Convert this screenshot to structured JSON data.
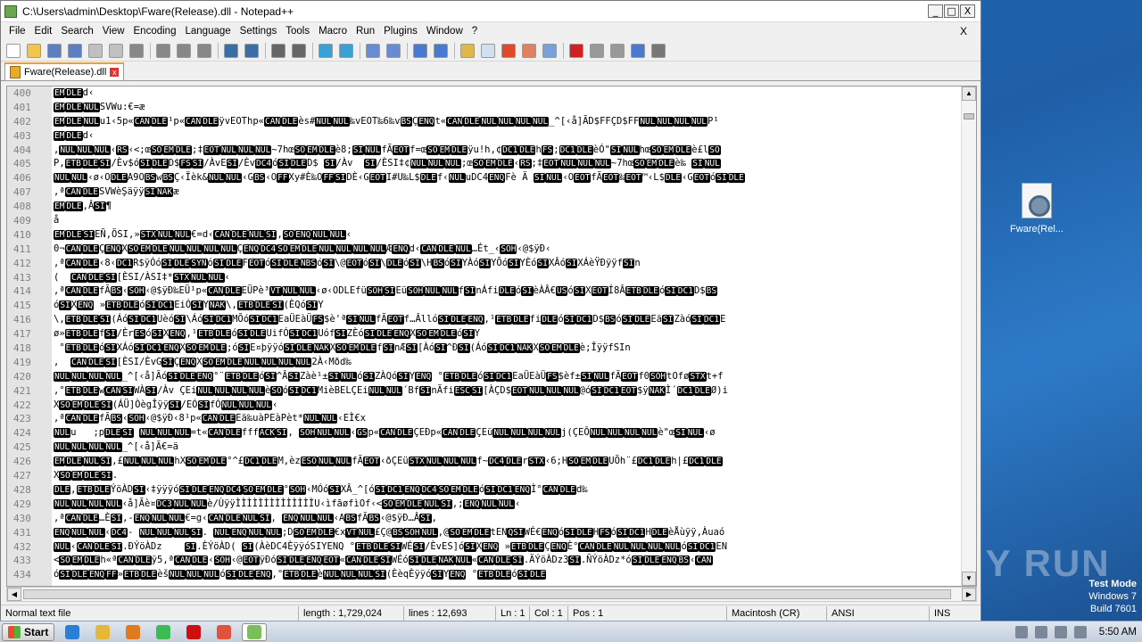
{
  "window": {
    "title": "C:\\Users\\admin\\Desktop\\Fware(Release).dll - Notepad++",
    "min_label": "_",
    "max_label": "□",
    "close_label": "X"
  },
  "menu": {
    "items": [
      "File",
      "Edit",
      "Search",
      "View",
      "Encoding",
      "Language",
      "Settings",
      "Tools",
      "Macro",
      "Run",
      "Plugins",
      "Window",
      "?"
    ],
    "close_label": "X"
  },
  "toolbar": {
    "icons": [
      "new-file-icon",
      "open-file-icon",
      "save-icon",
      "save-all-icon",
      "close-icon",
      "close-all-icon",
      "print-icon",
      "cut-icon",
      "copy-icon",
      "paste-icon",
      "undo-icon",
      "redo-icon",
      "find-icon",
      "replace-icon",
      "zoom-in-icon",
      "zoom-out-icon",
      "sync-v-icon",
      "sync-h-icon",
      "word-wrap-icon",
      "show-all-chars-icon",
      "indent-guide-icon",
      "doc-map-icon",
      "function-list-icon",
      "folder-workspace-icon",
      "monitoring-icon",
      "record-macro-icon",
      "stop-macro-icon",
      "play-macro-icon",
      "play-multiple-icon",
      "save-macro-icon"
    ]
  },
  "tab": {
    "label": "Fware(Release).dll",
    "close_label": "x"
  },
  "editor": {
    "line_numbers": [
      "400",
      "401",
      "402",
      "403",
      "404",
      "405",
      "406",
      "407",
      "408",
      "409",
      "410",
      "411",
      "412",
      "413",
      "414",
      "415",
      "416",
      "417",
      "418",
      "419",
      "420",
      "421",
      "422",
      "423",
      "424",
      "425",
      "426",
      "427",
      "428",
      "429",
      "430",
      "431",
      "432",
      "433",
      "434"
    ],
    "lines": [
      "[EM][DLE]d‹",
      "[EM][DLE][NUL]SVWu:€=æ",
      "[EM][DLE][NUL]u1‹5p«[CAN][DLE]¹p«[CAN][DLE]ÿvEOThp«[CAN][DLE]ès#[NUL][NUL]‰vEOT‰6‰v[BS]Ç[ENQ]t«[CAN][DLE][NUL][NUL][NUL][NUL]_^[‹å]ÃD$FFÇD$FF[NUL][NUL][NUL][NUL]P¹",
      "[EM][DLE]d‹",
      ",[NUL][NUL][NUL]‹[RS]‹<;œ[SO][EM][DLE];‡[EOT][NUL][NUL][NUL]~7hœ[SO][EM][DLE]è8;[SI][NUL]fÃ[EOT]f=œ[SO][EM][DLE]ÿu!h,¢[DC1][DLE]h[FS];[DC1][DLE]èÓ\"[SI][NUL]hœ[SO][EM][DLE]è£l[SO]",
      "P,[ETB][DLE][SI]/Èv$ó[SI][DLE]D$[FS][SI]/ÀvE[SI]/Èv[DC4]ó[SI][DLE]D$ [SI]/Àv  [SI]/ÈSI‡¢[NUL][NUL][NUL];œ[SO][EM][DLE]‹[RS];‡[EOT][NUL][NUL][NUL]~7hœ[SO][EM][DLE]è‰ [SI][NUL]",
      "[NUL][NUL]‹ø‹O[DLE]A9O[BS]w[BS]Ç‹Ïèk&[NUL][NUL]‹G[BS]‹O[FF]Xy#È‰O[FF][SI]DÈ‹G[EOT]I#U‰L$[DLE]f‹[NUL]uDC4[ENQ]Fè Ä [SI][NUL]‹O[EOT]fÃ[EOT]‰[EOT]™‹L$[DLE]‹G[EOT]ó[SI][DLE]",
      ",ª[CAN][DLE]SVWèŞäÿÿ[SI][NAK]æ",
      "[EM][DLE],Â[SI]¶",
      "å",
      "[EM][DLE][SI]EÑ,ÖSI,»[STX][NUL][NUL]€=d‹[CAN][DLE][NUL][SI],[SO][ENQ][NUL][NUL]‹",
      "0¬[CAN][DLE]Ç[ENQ]X[SO][EM][DLE][NUL][NUL][NUL][NUL]Ç[ENQ][DC4][SO][EM][DLE][NUL][NUL][NUL][NUL]Æ[ENQ]d‹[CAN][DLE][NUL]…Ét_‹[SOH]‹@$ÿÐ‹",
      ",ª[CAN][DLE]‹8‹[DC1]R$ÿÓó[SI][DLE][SYN]ó[SI][DLE]F[EOT]ó[SI][DLE][NBS]ó[SI]\\@[EOT]ó[SI]\\[DLE]ó[SI]\\H[BS]ó[SI]YÀó[SI]YÕó[SI]YÈó[SI]XÂó[SI]XÁèŸÐÿÿf[SI]n",
      "(  [CAN][DLE][SI][ÈSI/ÀSI‡*[STX][NUL][NUL]‹",
      ",ª[CAN][DLE]fÃ[BS]‹[SOH]‹@$ÿÐ‰EÜ¹p«[CAN][DLE]EÜPè³[VT][NUL][NUL]‹ø‹ODLEfü[SOH][SI]Eü[SOH][NUL][NUL]f[SI]nÁfi[DLE]ó[SI]èÀÂ€[US]ó[SI]X[EOT]Í8Â[ETB][DLE]ó[SI][DC1]D$[BS]",
      "ó[SI]X[ENQ] »[ETB][DLE]ó[SI][DC1]EiÓ[SI]Y[NAK]\\,[ETB][DLE][SI](ÈQó[SI]Y",
      "\\,[ETB][DLE][SI](Áó[SI][DC1]Uèó[SI]\\Áó[SI][DC1]MÕó[SI][DC1]EaÜEàÜ[FS]$è'ª[SI][NUL]fÃ[EOT]f…Âlló[SI][DLE][ENQ],¹[ETB][DLE]fi[DLE]ó[SI][DC1]D$[BS]ó[SI][DLE]Eä[SI]Zàó[SI][DC1]E",
      "ø»[ETB][DLE]f[SI]/Èr[ES]ó[SI]X[ENQ],¹[ETB][DLE]ó[SI][DLE]UifÓ[SI][DC1]Uóf[SI]ZÈó[SI][DLE][ENQ]X[SO][EM][DLE]ó[SI]Y",
      " °[ETB][DLE]ó[SI]XÁó[SI][DC1][ENQ]X[SO][EM][DLE];ó[SI]E¤þÿÿó[SI][DLE][NAK]X[SO][EM][DLE]f[SI]nÆ[SI][Àó[SI]^Ð[SI](Áó[SI][DC1][NAK]X[SO][EM][DLE]è;ÎÿÿfSIn",
      ",  [CAN][DLE][SI][ÈSI/ÈvG[SI]Ç[ENQ]X[SO][EM][DLE][NUL][NUL][NUL][NUL]2À‹Mðd‰",
      "[NUL][NUL][NUL][NUL]_^[‹å]Ãó[SI][DLE][ENQ]°¨[ETB][DLE]ó[SI]^Â[SI]Zàè¹±[SI][NUL]ó[SI]ZÀQó[SI]Y[ENQ] °[ETB][DLE]ó[SI][DC1]EaÜEàÜ[FS]$èf±[SI][NUL]fÃ[EOT]f0[SOH]tOfø[STX]t+f",
      ",°[ETB][DLE]w[CAN][SI]WÀ[SI]/Àv ÇEi[NUL][NUL][NUL][NUL]è[SO]ó[SI][DC1]MièBELÇEi[NUL][NUL]´Bf[SI]nÃfi[ESC][SI][ÀÇD$[EOT][NUL][NUL][NUL]@ó[SI][DC1][EOT]$ÿ[NAK]Ì´[DC1][DLE]Ø)i",
      "X[SO][EM][DLE][SI](ÁÜ]ÒègÎÿÿ[SI]/EÓ[SI]fÓ[NUL][NUL][NUL]‹",
      ",ª[CAN][DLE]fÃ[BS]‹[SOH]‹@$ÿÐ‹8¹p«[CAN][DLE]Eä‰uàPEàPèt*[NUL][NUL]‹EÌ€x",
      "[NUL]u   ;p[DLE][SI] [NUL][NUL][NUL]=t«[CAN][DLE]fff[ACK][SI], [SOH][NUL][NUL]‹[GS]p«[CAN][DLE]ÇEÐp«[CAN][DLE]ÇEü[NUL][NUL][NUL][NUL]j(ÇEÔ[NUL][NUL][NUL][NUL]è\"œ[SI][NUL]‹ø",
      "[NUL][NUL][NUL][NUL]_^[‹å]Ã€=ä",
      "[EM][DLE][NUL][SI],£[NUL][NUL][NUL]hX[SO][EM][DLE]°^£[DC1][DLE]M,èz[ESO][NUL][NUL]fÃ[EOT]‹ðÇEü[STX][NUL][NUL][NUL]f~[DC4][DLE]r[STX]‹6;H[SO][EM][DLE]UÕh¨£[DC1][DLE]h|£[DC1][DLE]",
      "X[SO][EM][DLE][SI].",
      "[DLE],[ETB][DLE]ÝöÀD[SI]‹‡ÿÿÿó[SI][DLE][ENQ][DC4][SO][EM][DLE]°[SOH]‹MÓó[SI]XÂ_^[ó[SI][DC1][ENQ][DC4][SO][EM][DLE]ó[SI][DC1][ENQ]Ì°[CAN][DLE]d‰",
      "[NUL][NUL][NUL][NUL]‹å]Ãè¤[DC3][NUL][NUL]è/ÙÿÿÌÌÌÌÌÌÌÌÌÌÌÌÌÌU‹ìfãøfìOf‹<[SO][EM][DLE][NUL][SI],;[ENQ][NUL][NUL]‹",
      ",ª[CAN][DLE]…È[SI],-[ENQ][NUL][NUL]€=g‹[CAN][DLE][NUL][SI], [ENQ][NUL][NUL]‹A[BS]fÃ[BS]‹@$ÿÐ…Â[SI],",
      "[ENQ][NUL][NUL]‹[DC4]- [NUL][NUL][NUL][SI]. [NUL][ENQ][NUL][NUL];D[SO][EM][DLE]€x[VT][NUL]£Ç@[BS][SOH][NUL],@[SO][EM][DLE]tEN[QSI]WÉ€[ENQ]ó[SI][DLE]H[FS]ó[SI][DC1]H[DLE]èÅùÿÿ,Àuaó",
      "[NUL]‹[CAN][DLE][SI].ÐÝöÀDz    [SI].ÈÝöÀD( [SI](ÀèDC4ÈÿÿóSIYENQ °[ETB][DLE][SI]WÉ[SI]/ÈvES]ó[SI]X[ENQ] »[ETB][DLE]Ç[ENQ]È°[CAN][DLE][NUL][NUL][NUL][NUL]ó[SI][DC1]EN",
      "<[SO][EM][DLE]h«ª[CAN][DLE]ÿ5,ª[CAN][DLE]‹[SOH]‹@[EOT]ÿÐó[SI][DLE][ENQ][EOT]«[CAN][DLE][SI]WÉó[SI][DLE][NAK][NUL]«[CAN][DLE][SI].ÄÝöÀDz3[SI].ÑÝöÀDz*ó[SI][DLE][ENQ][BS]‹[CAN]",
      "ó[SI][DLE][ENQ][FF]»[ETB][DLE]èš[NUL][NUL][NUL]ó[SI][DLE][ENQ],°[ETB][DLE]è[NUL][NUL][NUL][SI](ÈèqÈÿÿó[SI]Y[ENQ] °[ETB][DLE]ó[SI][DLE]"
    ]
  },
  "statusbar": {
    "type": "Normal text file",
    "length": "length : 1,729,024",
    "lines": "lines : 12,693",
    "ln": "Ln : 1",
    "col": "Col : 1",
    "pos": "Pos : 1",
    "eol": "Macintosh (CR)",
    "encoding": "ANSI",
    "mode": "INS"
  },
  "desktop": {
    "icon_label": "Fware(Rel...",
    "watermark": "ANY RUN",
    "os_line1": "Test Mode",
    "os_line2": "Windows 7",
    "os_line3": "Build 7601"
  },
  "taskbar": {
    "start_label": "Start",
    "clock": "5:50 AM",
    "apps": [
      "ie-icon",
      "explorer-icon",
      "media-player-icon",
      "chrome-icon",
      "opera-icon",
      "colorful-app-icon",
      "notepadpp-icon"
    ],
    "app_colors": [
      "#2a7fd4",
      "#e6b83a",
      "#e07a1e",
      "#3cba54",
      "#cc1010",
      "#e0533a",
      "#7bbf5a"
    ]
  },
  "colors": {
    "control_char_bg": "#000000",
    "gutter_bg": "#e4e4e4",
    "desktop_bg": "#1f5fa8"
  }
}
